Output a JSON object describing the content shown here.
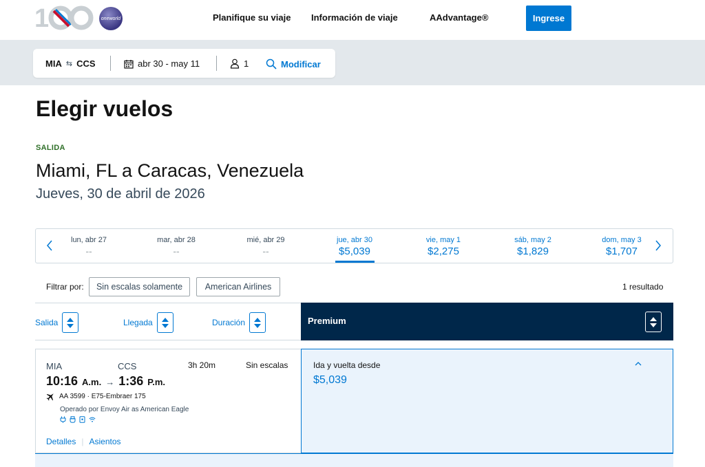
{
  "header": {
    "nav": {
      "plan": "Planifique su viaje",
      "info": "Información de viaje",
      "aadvantage": "AAdvantage®"
    },
    "login_label": "Ingrese",
    "oneworld_text": "oneworld",
    "colors": {
      "brand_blue": "#0078d2",
      "navy": "#00274a"
    }
  },
  "summary": {
    "origin": "MIA",
    "destination": "CCS",
    "dates": "abr 30 - may 11",
    "passengers": "1",
    "modify_label": "Modificar"
  },
  "page": {
    "title": "Elegir vuelos",
    "direction_label": "SALIDA",
    "route_title": "Miami, FL a Caracas, Venezuela",
    "date_sub": "Jueves, 30 de abril de 2026"
  },
  "date_strip": {
    "days": [
      {
        "label": "lun, abr 27",
        "price": "--"
      },
      {
        "label": "mar, abr 28",
        "price": "--"
      },
      {
        "label": "mié, abr 29",
        "price": "--"
      },
      {
        "label": "jue, abr 30",
        "price": "$5,039"
      },
      {
        "label": "vie, may 1",
        "price": "$2,275"
      },
      {
        "label": "sáb, may 2",
        "price": "$1,829"
      },
      {
        "label": "dom, may 3",
        "price": "$1,707"
      }
    ],
    "selected_index": 3
  },
  "filters": {
    "label": "Filtrar por:",
    "chips": [
      "Sin escalas solamente",
      "American Airlines"
    ],
    "result_count": "1 resultado"
  },
  "sort": {
    "salida": "Salida",
    "llegada": "Llegada",
    "duracion": "Duración",
    "cabin": "Premium"
  },
  "flight": {
    "origin": "MIA",
    "destination": "CCS",
    "duration": "3h 20m",
    "stops": "Sin escalas",
    "dep_time": "10:16",
    "dep_ampm": "A.m.",
    "arr_time": "1:36",
    "arr_ampm": "P.m.",
    "flight_info": "AA 3599 · E75-Embraer 175",
    "operated_by": "Operado por Envoy Air as American Eagle",
    "links": {
      "details": "Detalles",
      "seats": "Asientos"
    }
  },
  "fare": {
    "label": "Ida y vuelta desde",
    "price": "$5,039"
  }
}
